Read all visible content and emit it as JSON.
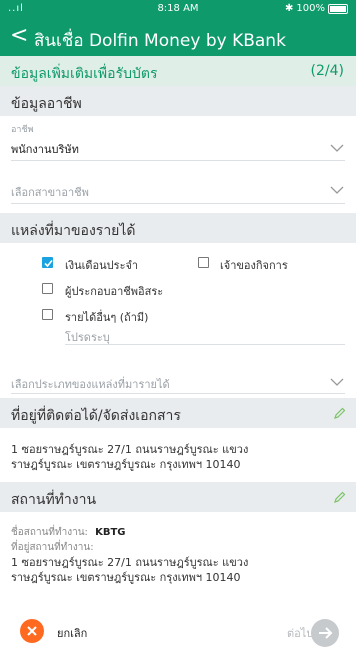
{
  "status_bar": {
    "signal": "..ıl",
    "time": "8:18 AM",
    "bluetooth": "✱",
    "battery": "100%"
  },
  "nav": {
    "back": "<",
    "title": "สินเชื่อ Dolfin Money by KBank"
  },
  "step": {
    "title": "ข้อมูลเพิ่มเติมเพื่อรับบัตร",
    "indicator": "(2/4)"
  },
  "occupation": {
    "section_title": "ข้อมูลอาชีพ",
    "field_label": "อาชีพ",
    "field_value": "พนักงานบริษัท",
    "branch_placeholder": "เลือกสาขาอาชีพ"
  },
  "income": {
    "section_title": "แหล่งที่มาของรายได้",
    "options": [
      {
        "label": "เงินเดือนประจำ",
        "checked": true
      },
      {
        "label": "เจ้าของกิจการ",
        "checked": false
      },
      {
        "label": "ผู้ประกอบอาชีพอิสระ",
        "checked": false
      },
      {
        "label": "รายได้อื่นๆ (ถ้ามี)",
        "checked": false
      }
    ],
    "specify_placeholder": "โปรดระบุ",
    "type_placeholder": "เลือกประเภทของแหล่งที่มารายได้"
  },
  "contact_address": {
    "section_title": "ที่อยู่ที่ติดต่อได้/จัดส่งเอกสาร",
    "line1": "1 ซอยราษฎร์บูรณะ 27/1 ถนนราษฎร์บูรณะ แขวง",
    "line2": "ราษฎร์บูรณะ เขตราษฎร์บูรณะ กรุงเทพฯ 10140"
  },
  "workplace": {
    "section_title": "สถานที่ทำงาน",
    "name_label": "ชื่อสถานที่ทำงาน:",
    "name_value": "KBTG",
    "address_label": "ที่อยู่สถานที่ทำงาน:",
    "line1": "1 ซอยราษฎร์บูรณะ 27/1 ถนนราษฎร์บูรณะ แขวง",
    "line2": "ราษฎร์บูรณะ เขตราษฎร์บูรณะ กรุงเทพฯ 10140"
  },
  "footer": {
    "cancel_label": "ยกเลิก",
    "next_label": "ต่อไป"
  },
  "colors": {
    "brand": "#0f9a6c",
    "accent": "#ff6a20",
    "checkbox": "#1aa3e0"
  }
}
